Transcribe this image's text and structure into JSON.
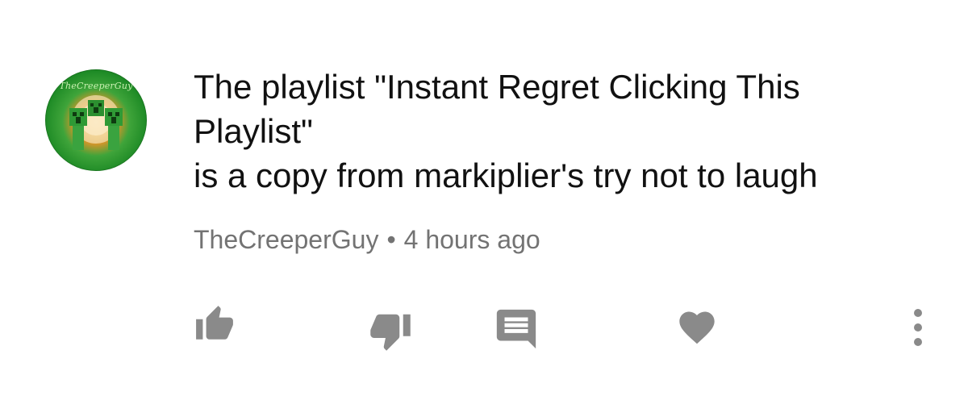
{
  "comment": {
    "avatar_label": "TheCreeperGuy",
    "lines": [
      "The playlist \"Instant Regret Clicking This",
      "Playlist\"",
      "is a copy from markiplier's try not to laugh"
    ],
    "author": "TheCreeperGuy",
    "separator": "•",
    "timestamp": "4 hours ago"
  },
  "actions": [
    {
      "name": "like-button",
      "icon": "thumbs-up-icon"
    },
    {
      "name": "dislike-button",
      "icon": "thumbs-down-icon"
    },
    {
      "name": "reply-button",
      "icon": "comment-icon"
    },
    {
      "name": "heart-button",
      "icon": "heart-icon"
    },
    {
      "name": "more-button",
      "icon": "more-vertical-icon"
    }
  ],
  "colors": {
    "text": "#111111",
    "meta": "#737373",
    "icon": "#8a8a8a"
  }
}
